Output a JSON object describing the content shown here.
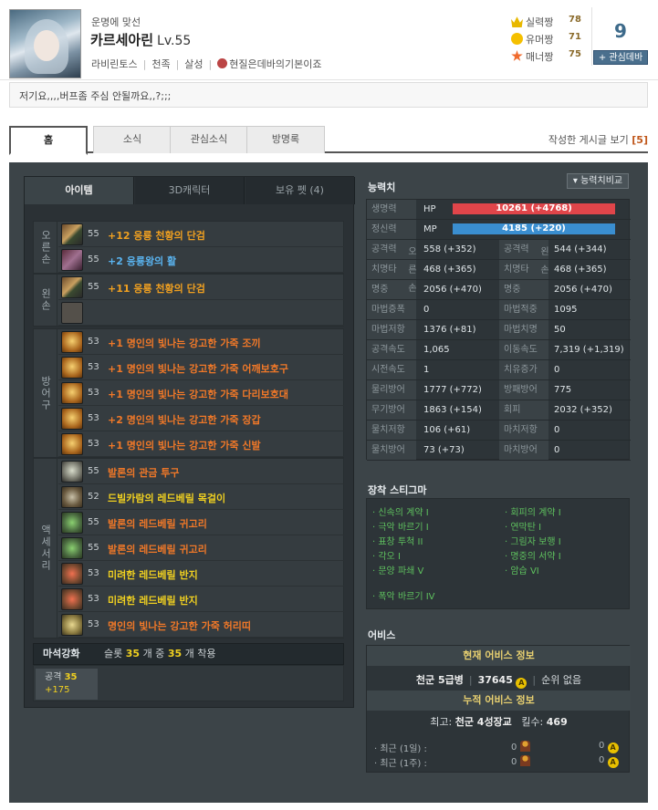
{
  "profile": {
    "tagline": "운명에 맞선",
    "name": "카르세아린",
    "level": "Lv.55",
    "server": "라비린토스",
    "race": "천족",
    "class": "살성",
    "guild": "현질은데바의기본이죠",
    "ranks": [
      {
        "label": "실력짱",
        "value": "78",
        "icon": "crown-icon"
      },
      {
        "label": "유머짱",
        "value": "71",
        "icon": "smile-icon"
      },
      {
        "label": "매너짱",
        "value": "75",
        "icon": "star-icon"
      }
    ],
    "fan_count": "9",
    "fan_button": "+ 관심데바"
  },
  "status_message": "저기요,,,,버프좀 주심 안될까요,,?;;;",
  "tabs": [
    "홈",
    "소식",
    "관심소식",
    "방명록"
  ],
  "posts": {
    "label": "작성한 게시글 보기",
    "count": "[5]"
  },
  "item_panel": {
    "tabs": [
      "아이템",
      "3D캐릭터",
      "보유 펫 (4)"
    ],
    "groups": [
      {
        "label": "오른손",
        "items": [
          {
            "level": "55",
            "name": "+12 응룡 천황의 단검",
            "color": "#f0a020",
            "icon": "dagger-icon"
          },
          {
            "level": "55",
            "name": "+2 응룡왕의 활",
            "color": "#5ab4f0",
            "icon": "bow-icon"
          }
        ]
      },
      {
        "label": "왼손",
        "items": [
          {
            "level": "55",
            "name": "+11 응룡 천황의 단검",
            "color": "#f0a020",
            "icon": "dagger-icon"
          },
          {
            "level": "",
            "name": "",
            "color": "",
            "icon": "empty-slot-icon"
          }
        ]
      },
      {
        "label": "방어구",
        "items": [
          {
            "level": "53",
            "name": "+1 명인의 빛나는 강고한 가죽 조끼",
            "color": "#f07828",
            "icon": "armor-icon"
          },
          {
            "level": "53",
            "name": "+1 명인의 빛나는 강고한 가죽 어깨보호구",
            "color": "#f07828",
            "icon": "armor-icon"
          },
          {
            "level": "53",
            "name": "+1 명인의 빛나는 강고한 가죽 다리보호대",
            "color": "#f07828",
            "icon": "armor-icon"
          },
          {
            "level": "53",
            "name": "+2 명인의 빛나는 강고한 가죽 장갑",
            "color": "#f07828",
            "icon": "armor-icon"
          },
          {
            "level": "53",
            "name": "+1 명인의 빛나는 강고한 가죽 신발",
            "color": "#f07828",
            "icon": "armor-icon"
          }
        ]
      },
      {
        "label": "액세서리",
        "items": [
          {
            "level": "55",
            "name": "발론의 관금 투구",
            "color": "#f07828",
            "icon": "helm-icon"
          },
          {
            "level": "52",
            "name": "드빌카람의 레드베릴 목걸이",
            "color": "#f0d020",
            "icon": "necklace-icon"
          },
          {
            "level": "55",
            "name": "발론의 레드베릴 귀고리",
            "color": "#f07828",
            "icon": "earring-icon"
          },
          {
            "level": "55",
            "name": "발론의 레드베릴 귀고리",
            "color": "#f07828",
            "icon": "earring-icon"
          },
          {
            "level": "53",
            "name": "미려한 레드베릴 반지",
            "color": "#f0d020",
            "icon": "ring-icon"
          },
          {
            "level": "53",
            "name": "미려한 레드베릴 반지",
            "color": "#f0d020",
            "icon": "ring-icon"
          },
          {
            "level": "53",
            "name": "명인의 빛나는 강고한 가죽 허리띠",
            "color": "#f07828",
            "icon": "belt-icon"
          }
        ]
      }
    ],
    "magic_stone": {
      "title": "마석강화",
      "desc_prefix": "슬롯",
      "slots": "35",
      "desc_mid": "개 중",
      "equipped": "35",
      "desc_suffix": "개 착용",
      "stat_label": "공격",
      "stat_value": "35",
      "stat_bonus": "+175"
    }
  },
  "stats": {
    "title": "능력치",
    "compare_button": "▾ 능력치비교",
    "hp_label": "생명력",
    "hp_tag": "HP",
    "hp_value": "10261 (+4768)",
    "mp_label": "정신력",
    "mp_tag": "MP",
    "mp_value": "4185 (+220)",
    "right_hand_label": "오른손",
    "left_hand_label": "왼손",
    "rows": [
      {
        "l1": "공격력",
        "v1": "558 (+352)",
        "l2": "공격력",
        "v2": "544 (+344)"
      },
      {
        "l1": "치명타",
        "v1": "468 (+365)",
        "l2": "치명타",
        "v2": "468 (+365)"
      },
      {
        "l1": "명중",
        "v1": "2056 (+470)",
        "l2": "명중",
        "v2": "2056 (+470)"
      },
      {
        "l1": "마법증폭",
        "v1": "0",
        "l2": "마법적중",
        "v2": "1095"
      },
      {
        "l1": "마법저항",
        "v1": "1376 (+81)",
        "l2": "마법치명",
        "v2": "50"
      },
      {
        "l1": "공격속도",
        "v1": "1,065",
        "l2": "이동속도",
        "v2": "7,319 (+1,319)"
      },
      {
        "l1": "시전속도",
        "v1": "1",
        "l2": "치유증가",
        "v2": "0"
      },
      {
        "l1": "물리방어",
        "v1": "1777 (+772)",
        "l2": "방패방어",
        "v2": "775"
      },
      {
        "l1": "무기방어",
        "v1": "1863 (+154)",
        "l2": "회피",
        "v2": "2032 (+352)"
      },
      {
        "l1": "물치저항",
        "v1": "106 (+61)",
        "l2": "마치저항",
        "v2": "0"
      },
      {
        "l1": "물치방어",
        "v1": "73 (+73)",
        "l2": "마치방어",
        "v2": "0"
      }
    ]
  },
  "stigma": {
    "title": "장착 스티그마",
    "left": [
      "신속의 계약 I",
      "극악 바르기 I",
      "표창 투척 II",
      "각오 I",
      "문양 파쇄 V"
    ],
    "right": [
      "회피의 계약 I",
      "연막탄 I",
      "그림자 보행 I",
      "명중의 서약 I",
      "암습 VI"
    ],
    "extra": "폭악 바르기 IV"
  },
  "abyss": {
    "title": "어비스",
    "current_header": "현재 어비스 정보",
    "rank": "천군 5급병",
    "points": "37645",
    "rank_status": "순위 없음",
    "total_header": "누적 어비스 정보",
    "best_label": "최고:",
    "best_rank": "천군 4성장교",
    "kills_label": "킬수:",
    "kills": "469",
    "recent": [
      {
        "label": "최근 (1일) :",
        "kills": "0",
        "points": "0"
      },
      {
        "label": "최근 (1주) :",
        "kills": "0",
        "points": "0"
      }
    ]
  }
}
